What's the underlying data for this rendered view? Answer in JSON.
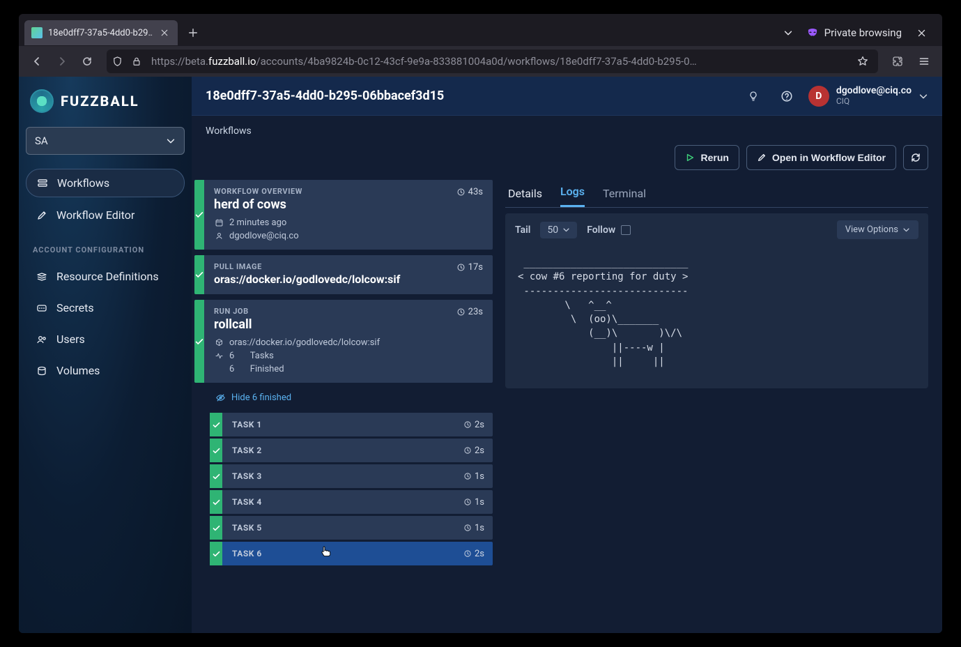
{
  "browser": {
    "tab_title": "18e0dff7-37a5-4dd0-b29…",
    "private_label": "Private browsing",
    "url_prefix": "https://beta.",
    "url_host": "fuzzball.io",
    "url_path": "/accounts/4ba9824b-0c12-43cf-9e9a-833881004a0d/workflows/18e0dff7-37a5-4dd0-b295-0…"
  },
  "brand": "FUZZBALL",
  "account_select": "SA",
  "sidebar": {
    "nav": [
      {
        "label": "Workflows"
      },
      {
        "label": "Workflow Editor"
      }
    ],
    "section": "ACCOUNT CONFIGURATION",
    "config": [
      {
        "label": "Resource Definitions"
      },
      {
        "label": "Secrets"
      },
      {
        "label": "Users"
      },
      {
        "label": "Volumes"
      }
    ]
  },
  "header": {
    "title": "18e0dff7-37a5-4dd0-b295-06bbacef3d15",
    "user_initial": "D",
    "user_email": "dgodlove@ciq.co",
    "user_org": "CIQ"
  },
  "breadcrumb": "Workflows",
  "actions": {
    "rerun": "Rerun",
    "open_editor": "Open in Workflow Editor"
  },
  "overview": {
    "label": "WORKFLOW OVERVIEW",
    "name": "herd of cows",
    "time": "43s",
    "when": "2 minutes ago",
    "author": "dgodlove@ciq.co"
  },
  "pull": {
    "label": "PULL IMAGE",
    "image": "oras://docker.io/godlovedc/lolcow:sif",
    "time": "17s"
  },
  "job": {
    "label": "RUN JOB",
    "name": "rollcall",
    "image": "oras://docker.io/godlovedc/lolcow:sif",
    "time": "23s",
    "tasks_total": "6",
    "tasks_total_label": "Tasks",
    "tasks_finished": "6",
    "tasks_finished_label": "Finished"
  },
  "hide_finished": "Hide 6 finished",
  "tasks": [
    {
      "label": "TASK 1",
      "time": "2s"
    },
    {
      "label": "TASK 2",
      "time": "2s"
    },
    {
      "label": "TASK 3",
      "time": "1s"
    },
    {
      "label": "TASK 4",
      "time": "1s"
    },
    {
      "label": "TASK 5",
      "time": "1s"
    },
    {
      "label": "TASK 6",
      "time": "2s"
    }
  ],
  "tabs": {
    "details": "Details",
    "logs": "Logs",
    "terminal": "Terminal"
  },
  "log_controls": {
    "tail": "Tail",
    "tail_value": "50",
    "follow": "Follow",
    "view_options": "View Options"
  },
  "log_output": " ____________________________\n< cow #6 reporting for duty >\n ----------------------------\n        \\   ^__^\n         \\  (oo)\\_______\n            (__)\\       )\\/\\\n                ||----w |\n                ||     ||"
}
